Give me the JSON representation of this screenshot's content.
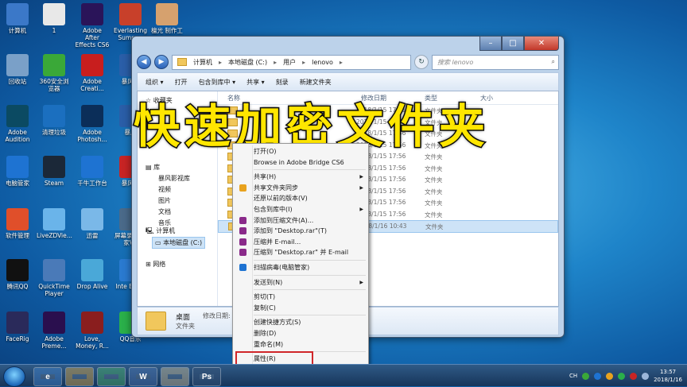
{
  "desktop": {
    "icons": [
      {
        "label": "计算机",
        "color": "#3b78c8"
      },
      {
        "label": "1",
        "color": "#e8e8e8"
      },
      {
        "label": "Adobe After Effects CS6",
        "color": "#2a1459"
      },
      {
        "label": "Everlasting Summ...",
        "color": "#c8402a"
      },
      {
        "label": "檀光 制作工",
        "color": "#d6a16e"
      },
      {
        "label": "回收站",
        "color": "#7aa0c8"
      },
      {
        "label": "360安全浏览器",
        "color": "#3aa838"
      },
      {
        "label": "Adobe Creati...",
        "color": "#c81e1e"
      },
      {
        "label": "暴风影",
        "color": "#2a5ea8"
      },
      {
        "label": "Adobe Audition",
        "color": "#0b4a62"
      },
      {
        "label": "清理垃圾",
        "color": "#1b6fbf"
      },
      {
        "label": "Adobe Photosh...",
        "color": "#0b2e59"
      },
      {
        "label": "暴风",
        "color": "#2a5ea8"
      },
      {
        "label": "电脑管家",
        "color": "#1e73d2"
      },
      {
        "label": "Steam",
        "color": "#1b2838"
      },
      {
        "label": "千牛工作台",
        "color": "#1e73d2"
      },
      {
        "label": "暴风影",
        "color": "#c82424"
      },
      {
        "label": "软件管理",
        "color": "#e04f2a"
      },
      {
        "label": "LiveZDVie...",
        "color": "#6ab4ea"
      },
      {
        "label": "迅雷",
        "color": "#7ab8e8"
      },
      {
        "label": "屏幕录像 专家V2",
        "color": "#4a6a8a"
      },
      {
        "label": "腾讯QQ",
        "color": "#111111"
      },
      {
        "label": "QuickTime Player",
        "color": "#4a7ab8"
      },
      {
        "label": "Drop Alive",
        "color": "#4aa8d8"
      },
      {
        "label": "Inte Explo",
        "color": "#2a7ad0"
      },
      {
        "label": "FaceRig",
        "color": "#2a2a5a"
      },
      {
        "label": "Adobe Preme...",
        "color": "#2a0f4e"
      },
      {
        "label": "Love, Money, R...",
        "color": "#8a1e1e"
      },
      {
        "label": "QQ音乐",
        "color": "#2ab04a"
      }
    ]
  },
  "overlay_title": "快速加密文件夹",
  "explorer": {
    "breadcrumb": [
      "计算机",
      "本地磁盘 (C:)",
      "用户",
      "lenovo"
    ],
    "search_placeholder": "搜索 lenovo",
    "toolbar": [
      "组织 ▾",
      "打开",
      "包含到库中 ▾",
      "共享 ▾",
      "刻录",
      "新建文件夹"
    ],
    "nav": {
      "favorites": "收藏夹",
      "library": "库",
      "library_items": [
        "暴风影视库",
        "视频",
        "图片",
        "文档",
        "音乐"
      ],
      "computer": "计算机",
      "drive": "本地磁盘 (C:)",
      "network": "网络"
    },
    "columns": [
      "名称",
      "修改日期",
      "类型",
      "大小"
    ],
    "rows": [
      {
        "date": "2018/1/15 17:31",
        "type": "文件夹"
      },
      {
        "date": "2018/1/15 17:56",
        "type": "文件夹"
      },
      {
        "date": "2018/1/15 17:56",
        "type": "文件夹"
      },
      {
        "date": "2018/1/15 17:56",
        "type": "文件夹"
      },
      {
        "date": "2018/1/15 17:56",
        "type": "文件夹"
      },
      {
        "date": "2018/1/15 17:56",
        "type": "文件夹"
      },
      {
        "date": "2018/1/15 17:56",
        "type": "文件夹"
      },
      {
        "date": "2018/1/15 17:56",
        "type": "文件夹"
      },
      {
        "date": "2018/1/15 17:56",
        "type": "文件夹"
      },
      {
        "date": "2018/1/15 17:56",
        "type": "文件夹"
      },
      {
        "date": "2018/1/16 10:43",
        "type": "文件夹"
      }
    ],
    "details": {
      "name": "桌面",
      "modified_label": "修改日期: 201",
      "type": "文件夹"
    }
  },
  "context_menu": [
    {
      "label": "打开(O)",
      "icon": ""
    },
    {
      "label": "Browse in Adobe Bridge CS6",
      "icon": ""
    },
    {
      "sep": true
    },
    {
      "label": "共享(H)",
      "sub": true
    },
    {
      "label": "共享文件夹同步",
      "icon": "#e8a21e",
      "sub": true
    },
    {
      "label": "还原以前的版本(V)"
    },
    {
      "label": "包含到库中(I)",
      "sub": true
    },
    {
      "label": "添加到压缩文件(A)...",
      "icon": "#8a2a8a"
    },
    {
      "label": "添加到 \"Desktop.rar\"(T)",
      "icon": "#8a2a8a"
    },
    {
      "label": "压缩并 E-mail...",
      "icon": "#8a2a8a"
    },
    {
      "label": "压缩到 \"Desktop.rar\" 并 E-mail",
      "icon": "#8a2a8a"
    },
    {
      "sep": true
    },
    {
      "label": "扫描病毒(电脑管家)",
      "icon": "#1e73d2"
    },
    {
      "sep": true
    },
    {
      "label": "发送到(N)",
      "sub": true
    },
    {
      "sep": true
    },
    {
      "label": "剪切(T)"
    },
    {
      "label": "复制(C)"
    },
    {
      "sep": true
    },
    {
      "label": "创建快捷方式(S)"
    },
    {
      "label": "删除(D)"
    },
    {
      "label": "重命名(M)"
    },
    {
      "sep": true
    },
    {
      "label": "属性(R)"
    }
  ],
  "taskbar": {
    "apps": [
      "e",
      "",
      "",
      "W",
      "",
      "Ps"
    ],
    "tray": {
      "lang": "CH",
      "time": "13:57",
      "date": "2018/1/16"
    }
  },
  "colors": {
    "highlight_border": "#d0262a",
    "overlay_text": "#ffe600"
  }
}
